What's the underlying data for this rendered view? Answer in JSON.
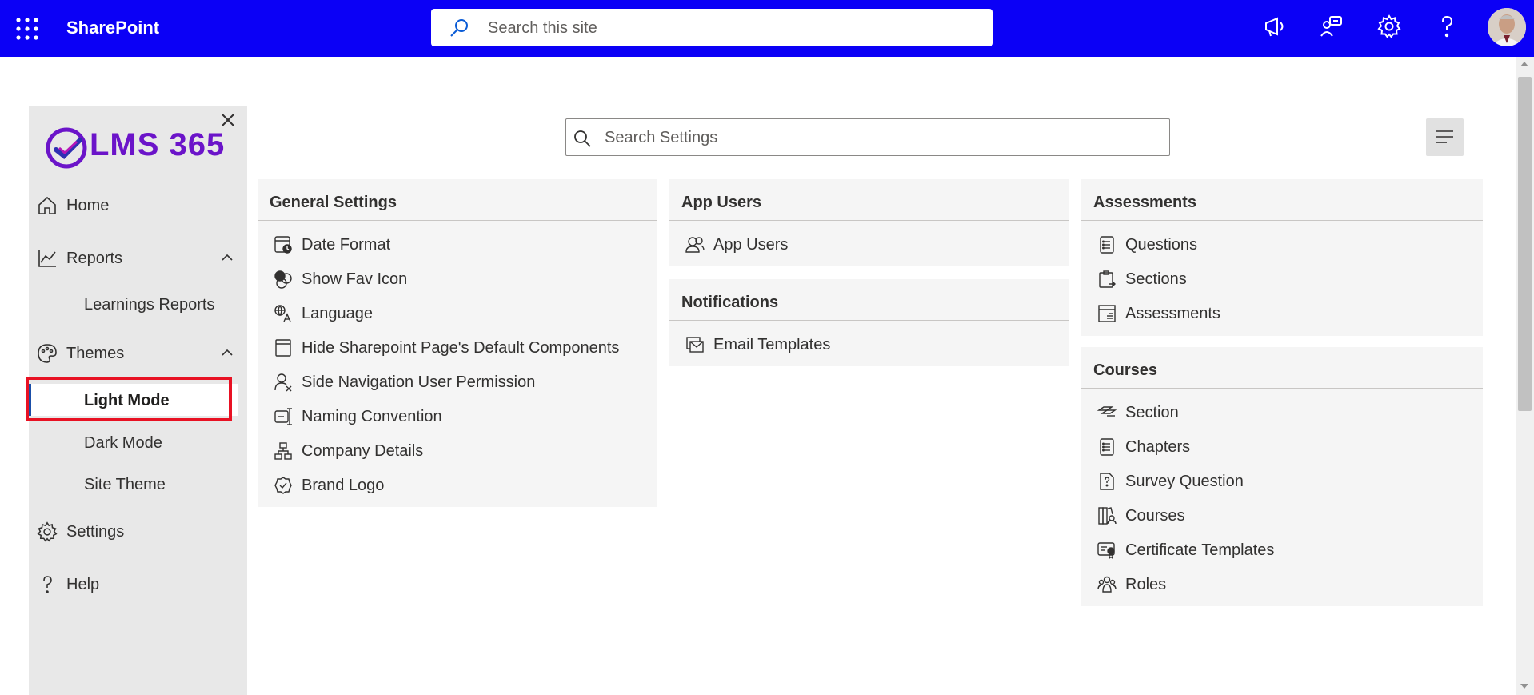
{
  "header": {
    "brand": "SharePoint",
    "search_placeholder": "Search this site",
    "accent": "#0b00f6"
  },
  "sidebar": {
    "logo_text": "LMS 365",
    "items": [
      {
        "label": "Home"
      },
      {
        "label": "Reports"
      },
      {
        "label": "Learnings Reports"
      },
      {
        "label": "Themes"
      },
      {
        "label": "Light Mode"
      },
      {
        "label": "Dark Mode"
      },
      {
        "label": "Site Theme"
      },
      {
        "label": "Settings"
      },
      {
        "label": "Help"
      }
    ],
    "active": "Light Mode",
    "highlight_color": "#e81123"
  },
  "main": {
    "search_placeholder": "Search Settings",
    "general": {
      "title": "General Settings",
      "items": [
        "Date Format",
        "Show Fav Icon",
        "Language",
        "Hide Sharepoint Page's Default Components",
        "Side Navigation User Permission",
        "Naming Convention",
        "Company Details",
        "Brand Logo"
      ]
    },
    "app_users": {
      "title": "App Users",
      "items": [
        "App Users"
      ]
    },
    "notifications": {
      "title": "Notifications",
      "items": [
        "Email Templates"
      ]
    },
    "assessments": {
      "title": "Assessments",
      "items": [
        "Questions",
        "Sections",
        "Assessments"
      ]
    },
    "courses": {
      "title": "Courses",
      "items": [
        "Section",
        "Chapters",
        "Survey Question",
        "Courses",
        "Certificate Templates",
        "Roles"
      ]
    }
  }
}
